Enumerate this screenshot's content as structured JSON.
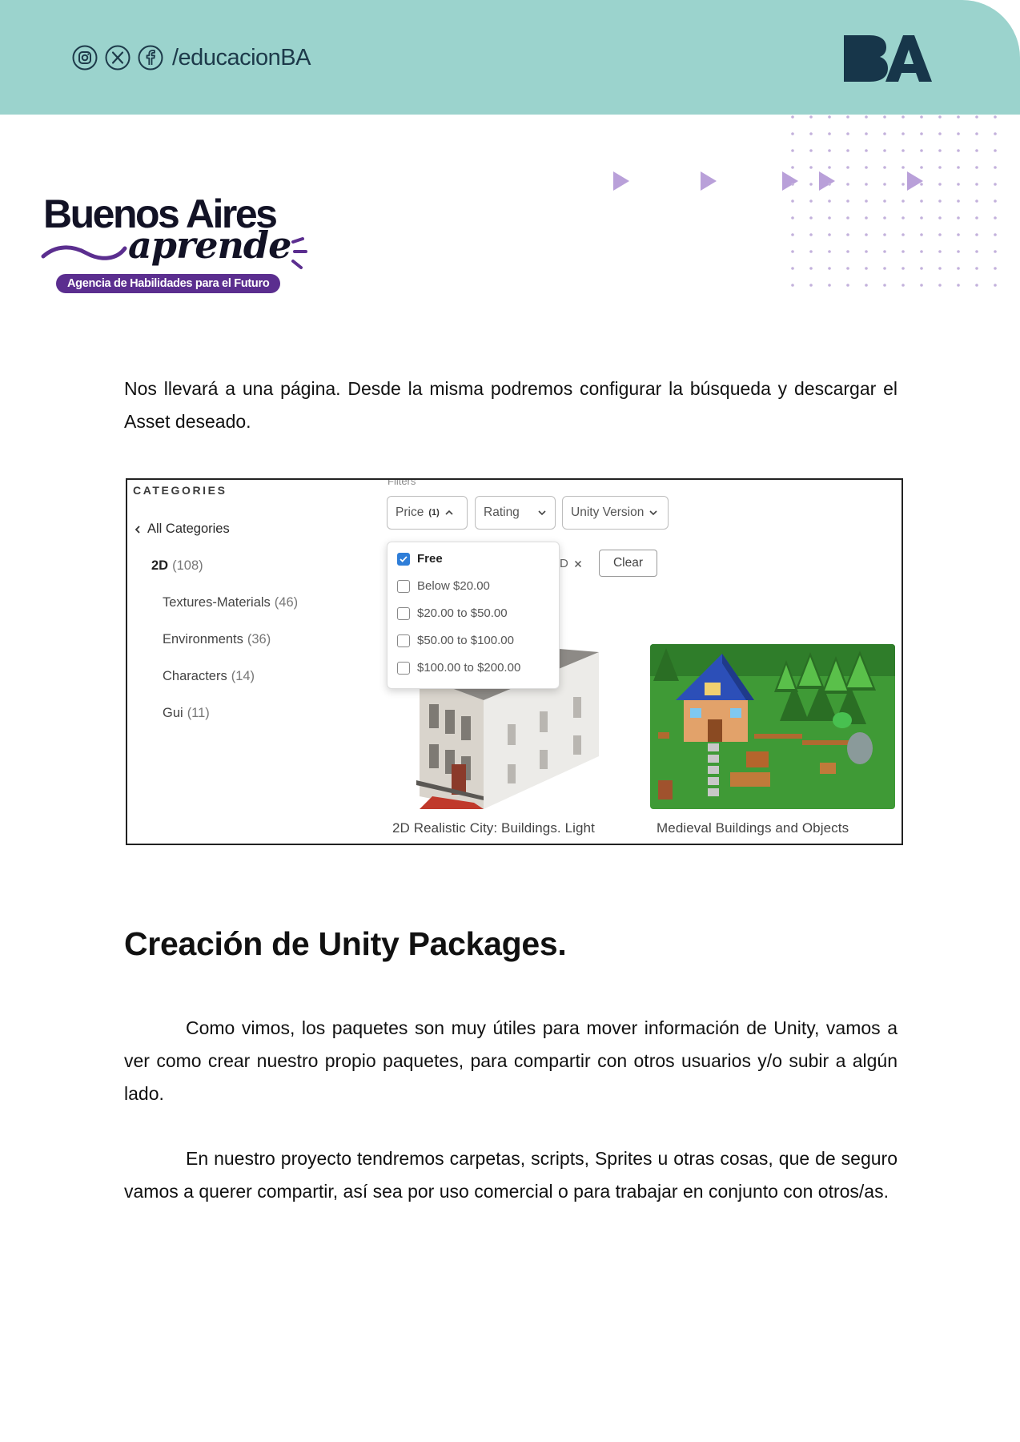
{
  "header": {
    "handle": "/educacionBA",
    "social_icons": [
      "instagram-icon",
      "x-icon",
      "facebook-icon"
    ],
    "logo": "BA",
    "band_color": "#9bd3cd",
    "logo_color": "#17364a"
  },
  "brand": {
    "line1": "Buenos Aires",
    "line2": "aprende",
    "tagline": "Agencia de Habilidades para el Futuro",
    "accent_color": "#5b2e8f"
  },
  "intro_paragraph": "Nos llevará a una página. Desde la misma podremos configurar la búsqueda y descargar el Asset deseado.",
  "asset_store": {
    "categories_heading": "CATEGORIES",
    "all_categories": "All Categories",
    "categories": [
      {
        "name": "2D",
        "count": "(108)"
      },
      {
        "name": "Textures-Materials",
        "count": "(46)"
      },
      {
        "name": "Environments",
        "count": "(36)"
      },
      {
        "name": "Characters",
        "count": "(14)"
      },
      {
        "name": "Gui",
        "count": "(11)"
      }
    ],
    "filters_label": "Filters",
    "filter_buttons": {
      "price": {
        "label": "Price",
        "count": "(1)"
      },
      "rating": {
        "label": "Rating"
      },
      "unity_version": {
        "label": "Unity Version"
      }
    },
    "active_chip_tail": "D",
    "clear_label": "Clear",
    "price_options": [
      {
        "label": "Free",
        "checked": true
      },
      {
        "label": "Below $20.00",
        "checked": false
      },
      {
        "label": "$20.00 to $50.00",
        "checked": false
      },
      {
        "label": "$50.00 to $100.00",
        "checked": false
      },
      {
        "label": "$100.00 to $200.00",
        "checked": false
      }
    ],
    "products": [
      {
        "title": "2D Realistic City: Buildings. Light"
      },
      {
        "title": "Medieval Buildings and Objects"
      }
    ],
    "checkbox_color": "#2f7ed8"
  },
  "section_title": "Creación de Unity Packages.",
  "paragraph_2": "Como vimos, los paquetes son muy útiles para mover información de Unity, vamos a ver como crear nuestro propio paquetes, para compartir con otros usuarios y/o subir a algún lado.",
  "paragraph_3": "En nuestro proyecto tendremos carpetas, scripts, Sprites u otras cosas, que de seguro vamos a querer compartir, así sea por uso comercial o para trabajar en conjunto con otros/as."
}
